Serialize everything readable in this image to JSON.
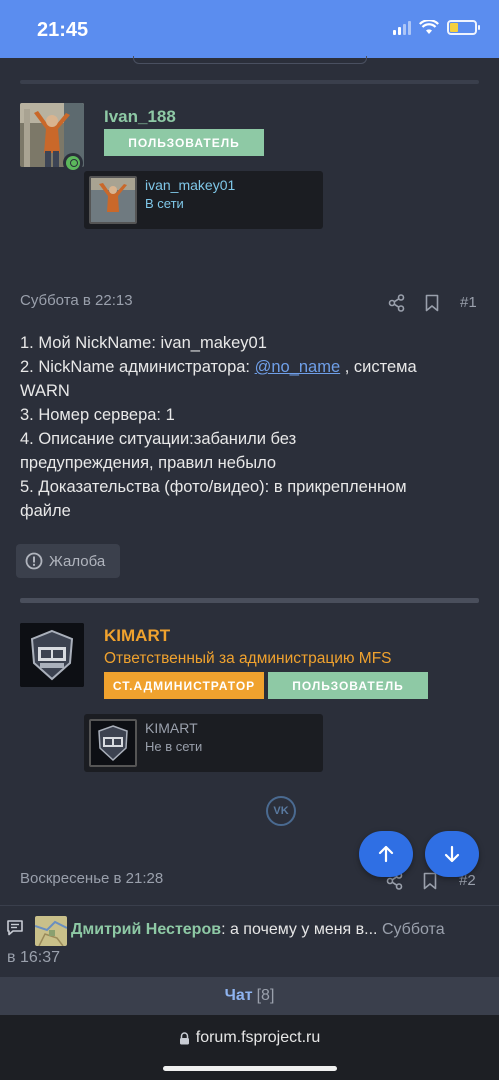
{
  "status_bar": {
    "time": "21:45"
  },
  "posts": [
    {
      "author": "Ivan_188",
      "role_badges": [
        "ПОЛЬЗОВАТЕЛЬ"
      ],
      "linked_account": {
        "name": "ivan_makey01",
        "status": "В сети"
      },
      "date": "Суббота в 22:13",
      "number": "#1",
      "body_lines": {
        "l1": "1. Мой NickName: ivan_makey01",
        "l2_prefix": "2. NickName администратора: ",
        "l2_mention": "@no_name",
        "l2_suffix": " , система",
        "l3": "WARN",
        "l4": "3. Номер сервера: 1",
        "l5": "4. Описание ситуации:забанили без",
        "l6": "предупреждения, правил небыло",
        "l7": "5. Доказательства (фото/видео): в прикрепленном",
        "l8": "файле"
      },
      "report_label": "Жалоба"
    },
    {
      "author": "KIMART",
      "title": "Ответственный за администрацию MFS",
      "role_badges": [
        "СТ.АДМИНИСТРАТОР",
        "ПОЛЬЗОВАТЕЛЬ"
      ],
      "linked_account": {
        "name": "KIMART",
        "status": "Не в сети"
      },
      "date": "Воскресенье в 21:28",
      "number": "#2"
    }
  ],
  "chat_preview": {
    "author": "Дмитрий Нестеров",
    "message": ": а почему у меня в...",
    "time_part1": " Суббота",
    "time_part2": "в 16:37"
  },
  "chat_bar": {
    "label": "Чат",
    "count": "[8]"
  },
  "browser": {
    "url": "forum.fsproject.ru"
  },
  "colors": {
    "accent": "#5b8def",
    "user_badge": "#8ec9a5",
    "admin_badge": "#f0a22e",
    "admin_name": "#f0a22e",
    "background": "#2b2f3a"
  },
  "icons": [
    "wifi-icon",
    "signal-icon",
    "battery-icon",
    "share-icon",
    "bookmark-icon",
    "report-icon",
    "vk-icon",
    "arrow-up-icon",
    "arrow-down-icon",
    "chat-icon",
    "lock-icon"
  ]
}
